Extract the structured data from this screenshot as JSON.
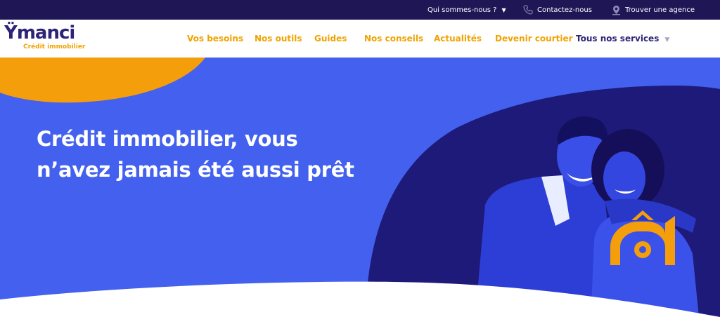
{
  "topbar": {
    "who_label": "Qui sommes-nous ?",
    "contact_label": "Contactez-nous",
    "agency_label": "Trouver une agence"
  },
  "logo": {
    "word": "Ÿmanci",
    "tagline": "Crédit immobilier"
  },
  "nav": {
    "items": [
      {
        "label": "Vos besoins"
      },
      {
        "label": "Nos outils"
      },
      {
        "label": "Guides"
      },
      {
        "label": "Nos conseils"
      },
      {
        "label": "Actualités"
      },
      {
        "label": "Devenir courtier"
      },
      {
        "label": "Tous nos services"
      }
    ]
  },
  "hero": {
    "title_line1": "Crédit immobilier, vous",
    "title_line2": "n’avez jamais été aussi prêt",
    "image": "smiling-couple-photo"
  },
  "colors": {
    "brand_navy": "#1f1656",
    "brand_blue": "#4361ee",
    "brand_orange": "#f0a300",
    "logo_purple": "#2e2477"
  },
  "icons": [
    "chevron-down-icon",
    "phone-icon",
    "location-pin-icon",
    "house-logo-icon"
  ]
}
